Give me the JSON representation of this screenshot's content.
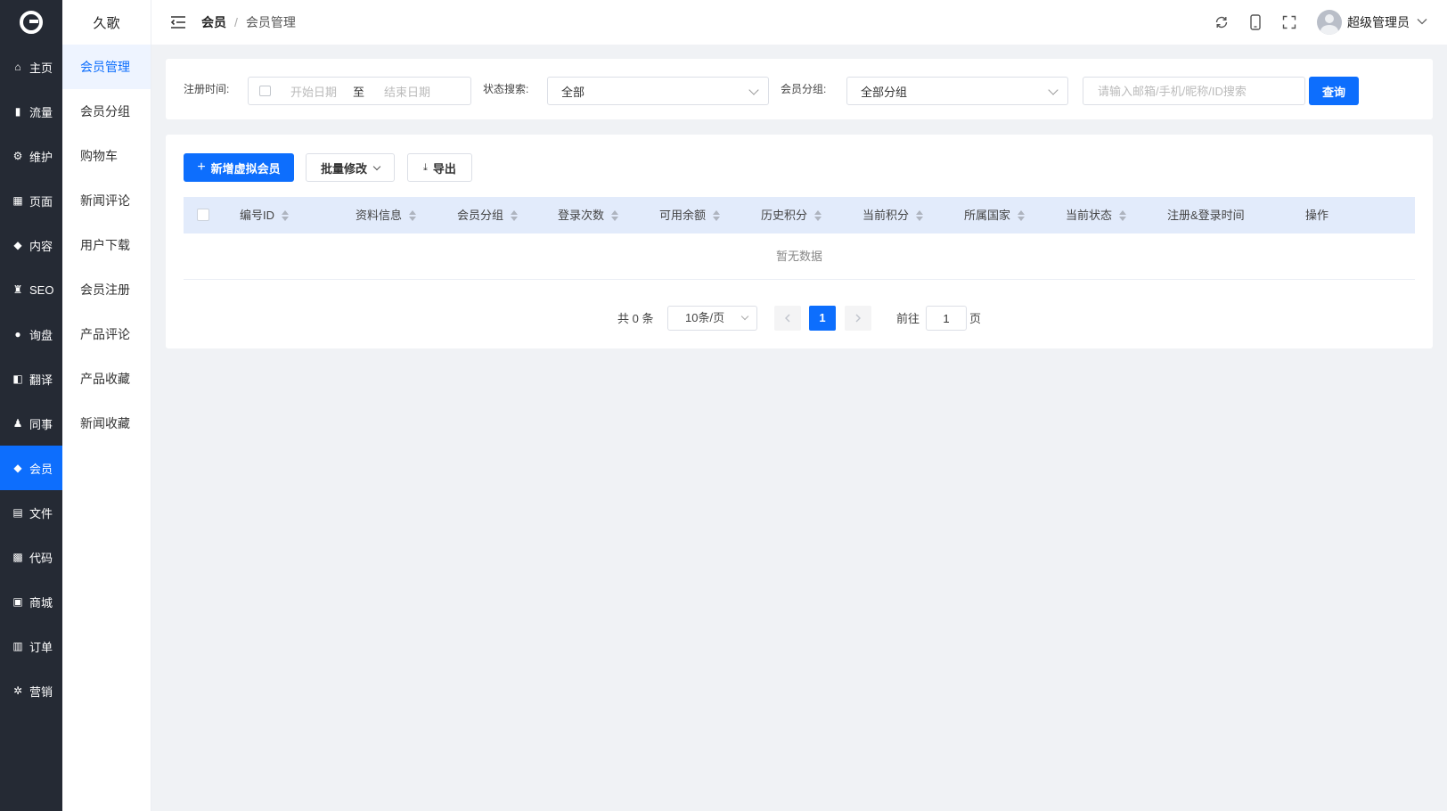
{
  "app": {
    "logo": "logo-icon"
  },
  "nav": {
    "items": [
      {
        "label": "主页",
        "icon": "home-icon",
        "glyph": "⌂"
      },
      {
        "label": "流量",
        "icon": "bar-chart-icon",
        "glyph": "▮"
      },
      {
        "label": "维护",
        "icon": "gear-icon",
        "glyph": "⚙"
      },
      {
        "label": "页面",
        "icon": "grid-icon",
        "glyph": "▦"
      },
      {
        "label": "内容",
        "icon": "cube-icon",
        "glyph": "◆"
      },
      {
        "label": "SEO",
        "icon": "trophy-icon",
        "glyph": "♜"
      },
      {
        "label": "询盘",
        "icon": "chat-icon",
        "glyph": "●"
      },
      {
        "label": "翻译",
        "icon": "translate-icon",
        "glyph": "◧"
      },
      {
        "label": "同事",
        "icon": "user-icon",
        "glyph": "♟"
      },
      {
        "label": "会员",
        "icon": "diamond-icon",
        "glyph": "◆",
        "active": true
      },
      {
        "label": "文件",
        "icon": "folder-icon",
        "glyph": "▤"
      },
      {
        "label": "代码",
        "icon": "code-icon",
        "glyph": "▩"
      },
      {
        "label": "商城",
        "icon": "shop-bag-icon",
        "glyph": "▣"
      },
      {
        "label": "订单",
        "icon": "order-icon",
        "glyph": "▥"
      },
      {
        "label": "营销",
        "icon": "marketing-icon",
        "glyph": "✲"
      }
    ]
  },
  "submenu": {
    "title": "久歌",
    "items": [
      {
        "label": "会员管理",
        "active": true
      },
      {
        "label": "会员分组"
      },
      {
        "label": "购物车"
      },
      {
        "label": "新闻评论"
      },
      {
        "label": "用户下载"
      },
      {
        "label": "会员注册"
      },
      {
        "label": "产品评论"
      },
      {
        "label": "产品收藏"
      },
      {
        "label": "新闻收藏"
      }
    ]
  },
  "header": {
    "breadcrumb_root": "会员",
    "breadcrumb_sep": "/",
    "breadcrumb_current": "会员管理",
    "user_name": "超级管理员"
  },
  "filters": {
    "reg_time_label": "注册时间:",
    "start_placeholder": "开始日期",
    "range_sep": "至",
    "end_placeholder": "结束日期",
    "status_label": "状态搜索:",
    "status_value": "全部",
    "group_label": "会员分组:",
    "group_value": "全部分组",
    "search_placeholder": "请输入邮箱/手机/昵称/ID搜索",
    "query_button": "查询"
  },
  "toolbar": {
    "add_button": "新增虚拟会员",
    "batch_button": "批量修改",
    "export_button": "导出"
  },
  "table": {
    "columns": [
      "编号ID",
      "资料信息",
      "会员分组",
      "登录次数",
      "可用余额",
      "历史积分",
      "当前积分",
      "所属国家",
      "当前状态",
      "注册&登录时间",
      "操作"
    ],
    "empty_text": "暂无数据"
  },
  "pagination": {
    "total": "共 0 条",
    "page_size": "10条/页",
    "current_page": "1",
    "goto_label": "前往",
    "goto_value": "1",
    "page_suffix": "页"
  },
  "colors": {
    "accent": "#0d6efd",
    "sidebar": "#252a34",
    "table_header": "#e2ebfb"
  }
}
